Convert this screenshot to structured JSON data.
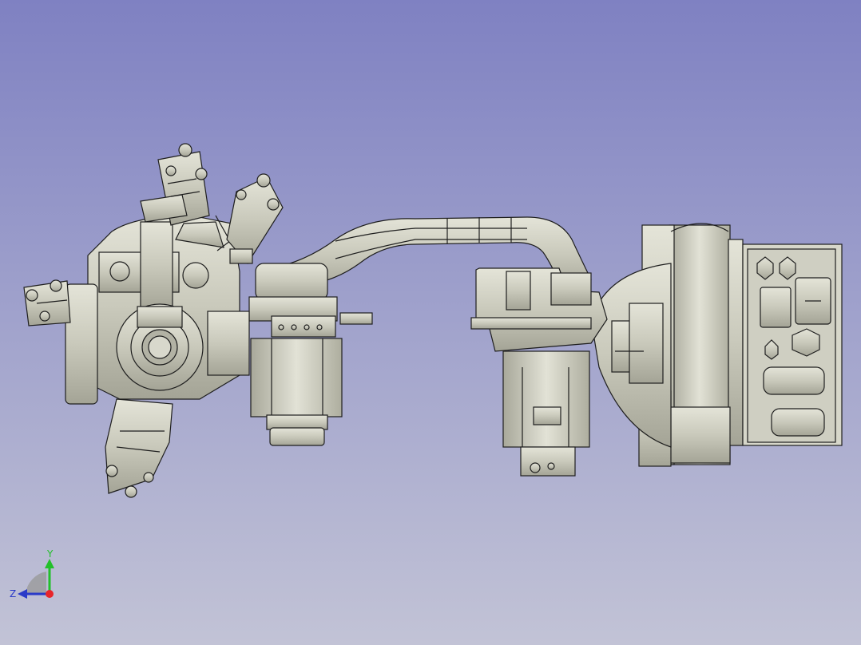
{
  "app": {
    "view": "3D CAD viewport"
  },
  "model": {
    "name": "robot-arm-assembly"
  },
  "axes": {
    "x_color": "#e8242a",
    "y_color": "#22c02a",
    "z_color": "#2a3ac8",
    "y_label": "Y",
    "z_label": "Z"
  },
  "colors": {
    "background_top": "#7f81c2",
    "background_bottom": "#c2c3d6",
    "part_fill": "#d4d4c6",
    "part_shadow": "#9e9e90",
    "edge": "#1e1e1e"
  }
}
